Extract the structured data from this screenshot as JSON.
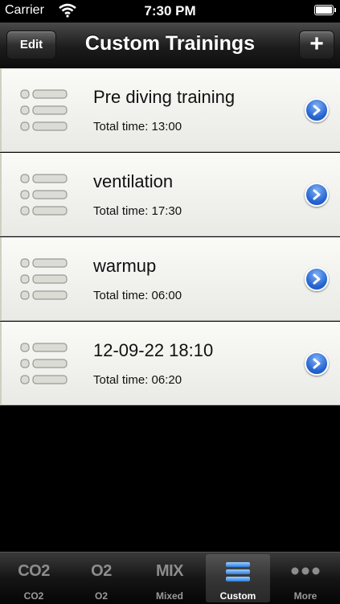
{
  "status_bar": {
    "carrier": "Carrier",
    "time": "7:30 PM"
  },
  "nav": {
    "title": "Custom Trainings",
    "edit_label": "Edit",
    "add_label": "+"
  },
  "trainings": [
    {
      "title": "Pre diving training",
      "subtitle": "Total time: 13:00"
    },
    {
      "title": "ventilation",
      "subtitle": "Total time: 17:30"
    },
    {
      "title": "warmup",
      "subtitle": "Total time: 06:00"
    },
    {
      "title": "12-09-22 18:10",
      "subtitle": "Total time: 06:20"
    }
  ],
  "tabs": [
    {
      "glyph": "CO2",
      "label": "CO2"
    },
    {
      "glyph": "O2",
      "label": "O2"
    },
    {
      "glyph": "MIX",
      "label": "Mixed"
    },
    {
      "glyph": "",
      "label": "Custom"
    },
    {
      "glyph": "",
      "label": "More"
    }
  ],
  "colors": {
    "accent_blue": "#2463d1",
    "nav_dark": "#1c1c1c"
  }
}
